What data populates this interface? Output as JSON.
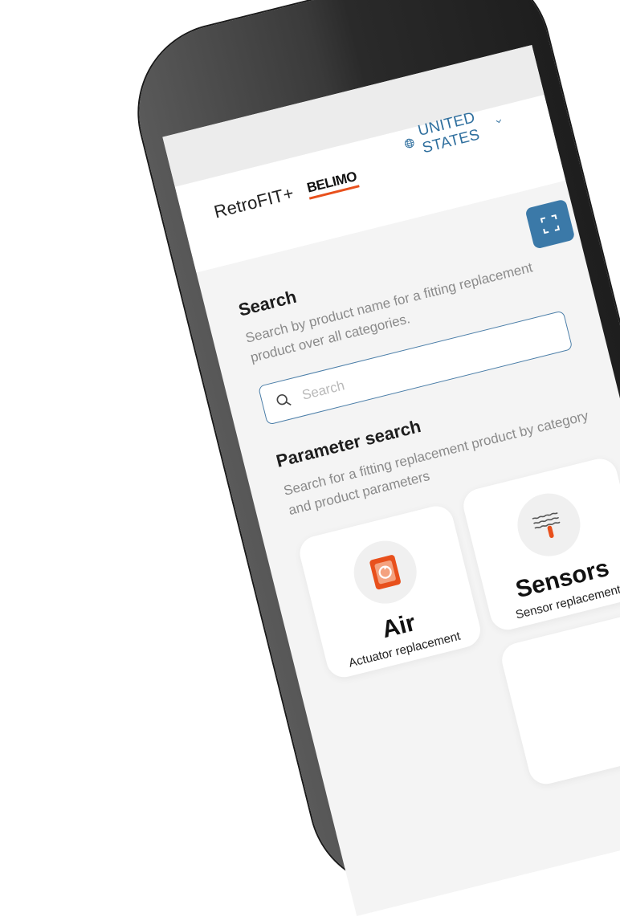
{
  "header": {
    "app_name": "RetroFIT+",
    "brand": "BELIMO",
    "country": "UNITED STATES"
  },
  "search": {
    "title": "Search",
    "description": "Search by product name for a fitting replacement product over all categories.",
    "placeholder": "Search"
  },
  "parameter_search": {
    "title": "Parameter search",
    "description": "Search for a fitting replacement product by category and product parameters"
  },
  "categories": [
    {
      "title": "Air",
      "subtitle": "Actuator replacement",
      "icon": "actuator-icon"
    },
    {
      "title": "Sensors",
      "subtitle": "Sensor replacement",
      "icon": "sensor-icon"
    }
  ],
  "colors": {
    "accent": "#3b79a8",
    "link": "#2f6f9e",
    "brand_orange": "#e8501c"
  }
}
